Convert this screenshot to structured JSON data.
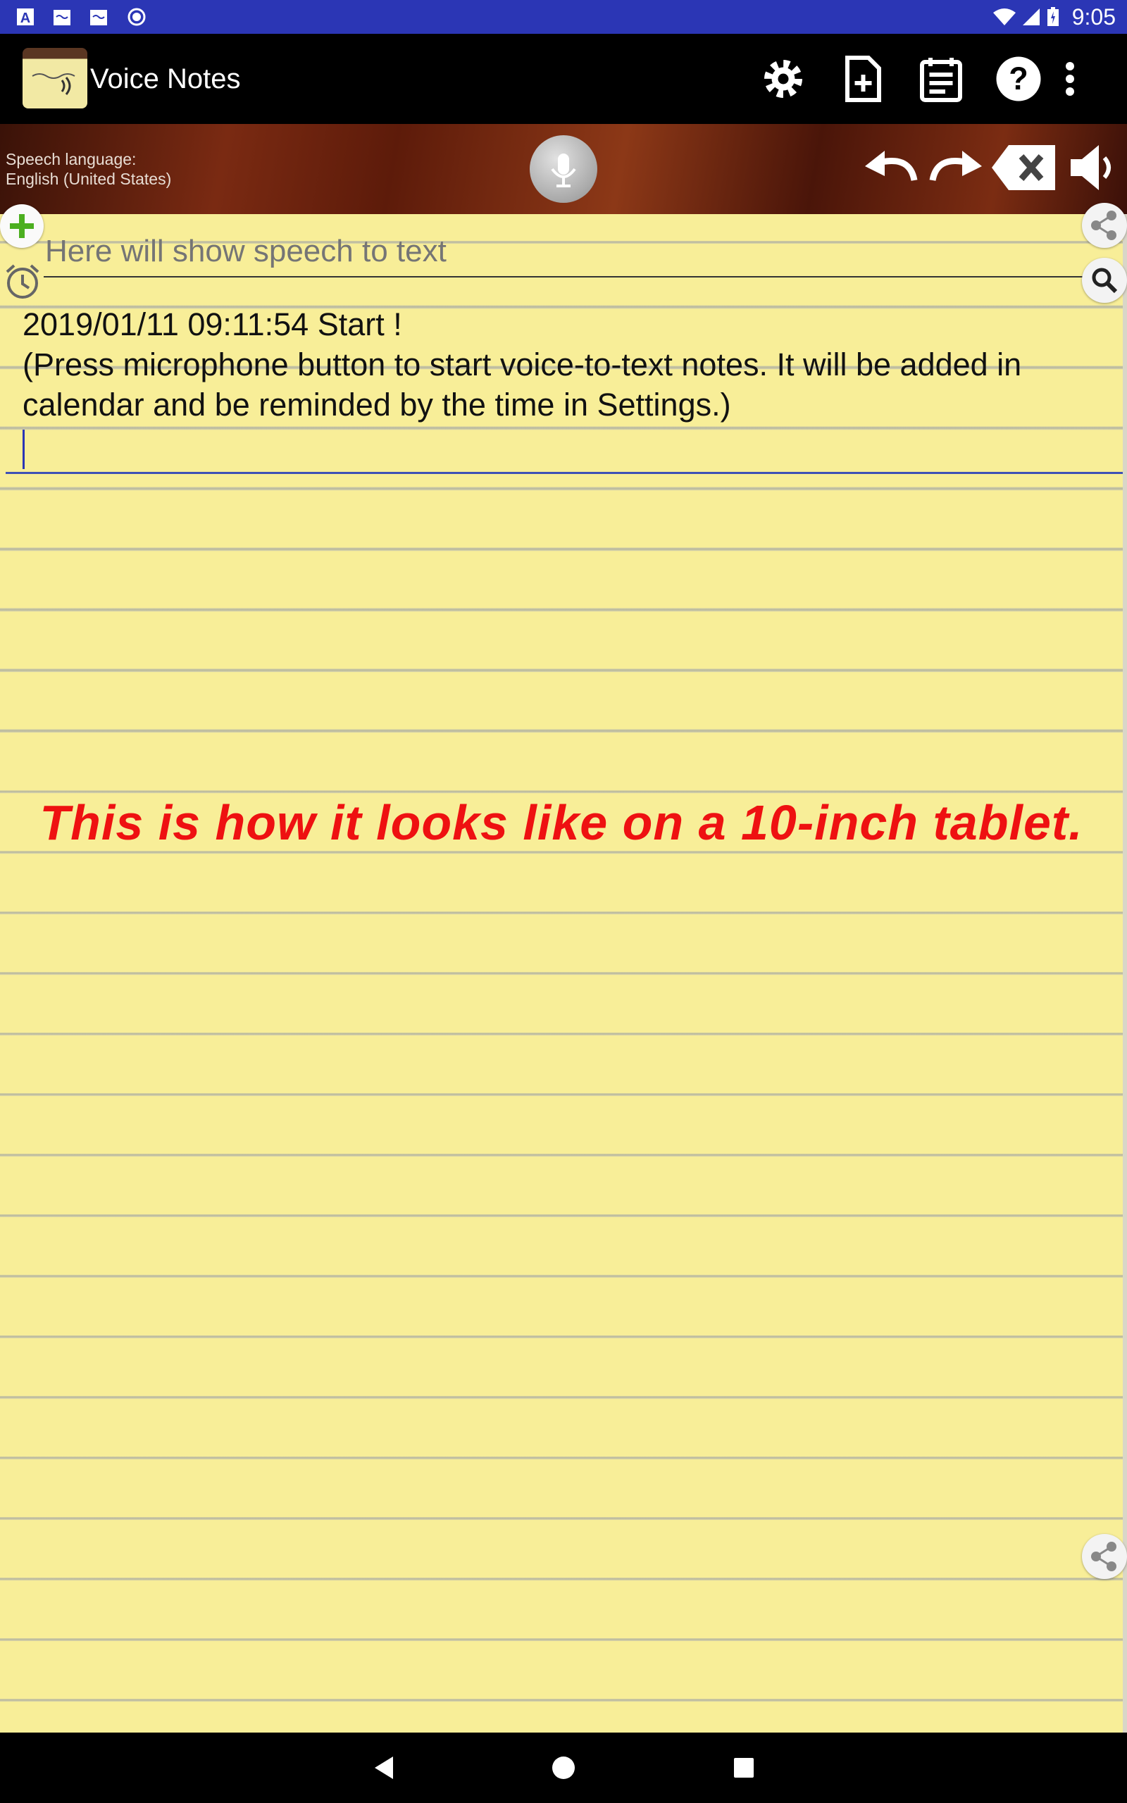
{
  "status_bar": {
    "time": "9:05",
    "icons": [
      "a-icon",
      "notes-icon",
      "notes-icon",
      "circle-icon",
      "wifi-icon",
      "signal-icon",
      "battery-icon"
    ]
  },
  "app_bar": {
    "title": "Voice Notes",
    "actions": [
      "settings-icon",
      "new-note-icon",
      "calendar-note-icon",
      "help-icon",
      "overflow-menu-icon"
    ]
  },
  "toolbar": {
    "language_label": "Speech language:",
    "language_value": "English (United States)",
    "buttons": [
      "microphone-icon",
      "undo-icon",
      "redo-icon",
      "clear-icon",
      "speaker-icon"
    ]
  },
  "editor": {
    "speech_placeholder": "Here will show speech to text",
    "note_line1": "2019/01/11 09:11:54 Start !",
    "note_line2": "(Press microphone button to start voice-to-text notes. It will be added in calendar and be reminded by the time in Settings.)"
  },
  "promo_text": "This is how it looks like on a 10-inch tablet.",
  "colors": {
    "status_bar": "#2b36b5",
    "paper": "#f8ee98",
    "placeholder": "#7ab3e6",
    "promo": "#ee1111",
    "underline": "#3f51b5"
  },
  "nav_bar": [
    "back-icon",
    "home-icon",
    "recents-icon"
  ]
}
